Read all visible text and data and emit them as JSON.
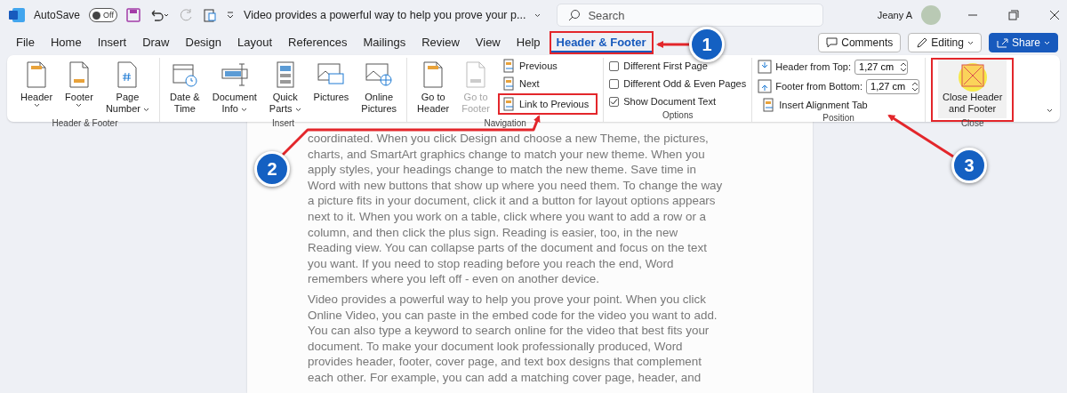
{
  "title_bar": {
    "autosave_label": "AutoSave",
    "autosave_toggle": {
      "label": "Off",
      "on": false
    },
    "document_title": "Video provides a powerful way to help you prove your p...",
    "search": {
      "placeholder": "Search"
    },
    "user_name": "Jeany A"
  },
  "tabs": [
    {
      "label": "File",
      "selected": false,
      "highlighted": false
    },
    {
      "label": "Home",
      "selected": false,
      "highlighted": false
    },
    {
      "label": "Insert",
      "selected": false,
      "highlighted": false
    },
    {
      "label": "Draw",
      "selected": false,
      "highlighted": false
    },
    {
      "label": "Design",
      "selected": false,
      "highlighted": false
    },
    {
      "label": "Layout",
      "selected": false,
      "highlighted": false
    },
    {
      "label": "References",
      "selected": false,
      "highlighted": false
    },
    {
      "label": "Mailings",
      "selected": false,
      "highlighted": false
    },
    {
      "label": "Review",
      "selected": false,
      "highlighted": false
    },
    {
      "label": "View",
      "selected": false,
      "highlighted": false
    },
    {
      "label": "Help",
      "selected": false,
      "highlighted": false
    },
    {
      "label": "Header & Footer",
      "selected": true,
      "highlighted": true
    }
  ],
  "actions": [
    {
      "label": "Comments",
      "kind": "outline"
    },
    {
      "label": "Editing",
      "kind": "dropdown"
    },
    {
      "label": "Share",
      "kind": "primary"
    }
  ],
  "ribbon": {
    "groups": [
      {
        "label": "Header & Footer",
        "highlighted": false,
        "items": [
          {
            "kind": "large",
            "lines": [
              "Header"
            ],
            "dropdown": true,
            "disabled": false,
            "highlighted": false
          },
          {
            "kind": "large",
            "lines": [
              "Footer"
            ],
            "dropdown": true,
            "disabled": false,
            "highlighted": false
          },
          {
            "kind": "large",
            "lines": [
              "Page",
              "Number"
            ],
            "dropdown": true,
            "disabled": false,
            "highlighted": false
          }
        ]
      },
      {
        "label": "Insert",
        "highlighted": false,
        "items": [
          {
            "kind": "large",
            "lines": [
              "Date &",
              "Time"
            ],
            "dropdown": false,
            "disabled": false,
            "highlighted": false
          },
          {
            "kind": "large",
            "lines": [
              "Document",
              "Info"
            ],
            "dropdown": true,
            "disabled": false,
            "highlighted": false
          },
          {
            "kind": "large",
            "lines": [
              "Quick",
              "Parts"
            ],
            "dropdown": true,
            "disabled": false,
            "highlighted": false
          },
          {
            "kind": "large",
            "lines": [
              "Pictures"
            ],
            "dropdown": false,
            "disabled": false,
            "highlighted": false
          },
          {
            "kind": "large",
            "lines": [
              "Online",
              "Pictures"
            ],
            "dropdown": false,
            "disabled": false,
            "highlighted": false
          }
        ]
      },
      {
        "label": "Navigation",
        "highlighted": false,
        "items": [
          {
            "kind": "large",
            "lines": [
              "Go to",
              "Header"
            ],
            "dropdown": false,
            "disabled": false,
            "highlighted": false
          },
          {
            "kind": "large",
            "lines": [
              "Go to",
              "Footer"
            ],
            "dropdown": false,
            "disabled": true,
            "highlighted": false
          },
          {
            "kind": "small",
            "label": "Previous",
            "highlighted": false
          },
          {
            "kind": "small",
            "label": "Next",
            "highlighted": false
          },
          {
            "kind": "small",
            "label": "Link to Previous",
            "highlighted": true
          }
        ]
      },
      {
        "label": "Options",
        "highlighted": false,
        "items": [
          {
            "kind": "checkbox",
            "label": "Different First Page",
            "checked": false
          },
          {
            "kind": "checkbox",
            "label": "Different Odd & Even Pages",
            "checked": false
          },
          {
            "kind": "checkbox",
            "label": "Show Document Text",
            "checked": true
          }
        ]
      },
      {
        "label": "Position",
        "highlighted": false,
        "items": [
          {
            "kind": "spinner",
            "label": "Header from Top:",
            "value": "1,27 cm"
          },
          {
            "kind": "spinner",
            "label": "Footer from Bottom:",
            "value": "1,27 cm"
          },
          {
            "kind": "small",
            "label": "Insert Alignment Tab",
            "highlighted": false
          }
        ]
      },
      {
        "label": "Close",
        "highlighted": true,
        "items": [
          {
            "kind": "large",
            "lines": [
              "Close Header",
              "and Footer"
            ],
            "dropdown": false,
            "disabled": false,
            "highlighted": false
          }
        ]
      }
    ]
  },
  "document": {
    "paragraphs": [
      {
        "lines": [
          "coordinated. When you click Design and choose a new Theme, the pictures,",
          "charts, and SmartArt graphics change to match your new theme. When you",
          "apply styles, your headings change to match the new theme. Save time in",
          "Word with new buttons that show up where you need them. To change the way",
          "a picture fits in your document, click it and a button for layout options appears",
          "next to it. When you work on a table, click where you want to add a row or a",
          "column, and then click the plus sign. Reading is easier, too, in the new",
          "Reading view. You can collapse parts of the document and focus on the text",
          "you want. If you need to stop reading before you reach the end, Word",
          "remembers where you left off - even on another device."
        ]
      },
      {
        "lines": [
          "Video provides a powerful way to help you prove your point. When you click",
          "Online Video, you can paste in the embed code for the video you want to add.",
          "You can also type a keyword to search online for the video that best fits your",
          "document. To make your document look professionally produced, Word",
          "provides header, footer, cover page, and text box designs that complement",
          "each other. For example, you can add a matching cover page, header, and"
        ]
      }
    ]
  },
  "callouts": [
    {
      "number": "1"
    },
    {
      "number": "2"
    },
    {
      "number": "3"
    }
  ]
}
